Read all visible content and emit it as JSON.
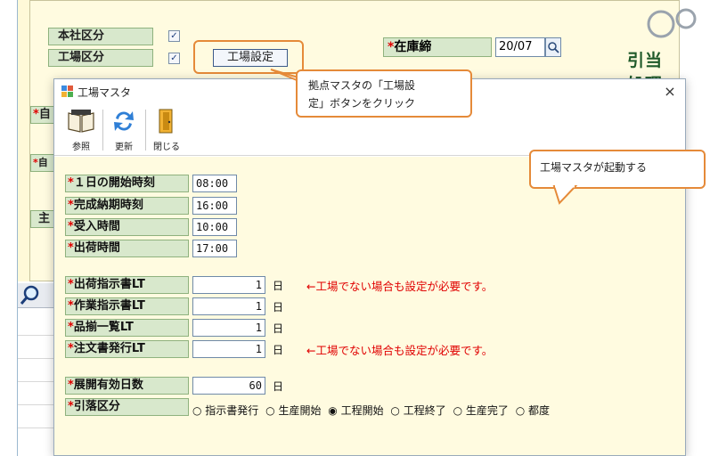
{
  "background": {
    "head_office_label": "本社区分",
    "factory_label": "工場区分",
    "factory_setting_button": "工場設定",
    "stock_cutoff_label": "在庫締",
    "stock_cutoff_required": "*",
    "stock_cutoff_value": "20/07",
    "right_title": "引当処理",
    "left_partial_1": "自",
    "left_partial_2": "自",
    "left_partial_3": "主"
  },
  "dialog": {
    "title": "工場マスタ",
    "close_symbol": "×",
    "toolbar": [
      {
        "label": "参照",
        "icon": "book-icon"
      },
      {
        "label": "更新",
        "icon": "refresh-icon"
      },
      {
        "label": "閉じる",
        "icon": "door-exit-icon"
      }
    ],
    "fields": [
      {
        "required": "*",
        "label": "１日の開始時刻",
        "value": "08:00"
      },
      {
        "required": "*",
        "label": "完成納期時刻",
        "value": "16:00"
      },
      {
        "required": "*",
        "label": "受入時間",
        "value": "10:00"
      },
      {
        "required": "*",
        "label": "出荷時間",
        "value": "17:00"
      }
    ],
    "lt_fields": [
      {
        "required": "*",
        "label": "出荷指示書LT",
        "value": "1",
        "unit": "日",
        "note": "←工場でない場合も設定が必要です。"
      },
      {
        "required": "*",
        "label": "作業指示書LT",
        "value": "1",
        "unit": "日",
        "note": ""
      },
      {
        "required": "*",
        "label": "品揃一覧LT",
        "value": "1",
        "unit": "日",
        "note": ""
      },
      {
        "required": "*",
        "label": "注文書発行LT",
        "value": "1",
        "unit": "日",
        "note": "←工場でない場合も設定が必要です。"
      }
    ],
    "expand_days": {
      "required": "*",
      "label": "展開有効日数",
      "value": "60",
      "unit": "日"
    },
    "deduction": {
      "required": "*",
      "label": "引落区分",
      "options": [
        {
          "label": "指示書発行",
          "selected": false
        },
        {
          "label": "生産開始",
          "selected": false
        },
        {
          "label": "工程開始",
          "selected": true
        },
        {
          "label": "工程終了",
          "selected": false
        },
        {
          "label": "生産完了",
          "selected": false
        },
        {
          "label": "都度",
          "selected": false
        }
      ]
    }
  },
  "callouts": {
    "click_button": "拠点マスタの「工場設定」ボタンをクリック",
    "click_button_line1": "拠点マスタの「工場設",
    "click_button_line2": "定」ボタンをクリック",
    "launch": "工場マスタが起動する"
  },
  "colors": {
    "form_background": "#fffbe0",
    "label_green": "#d8e8cc",
    "required_red": "#e00000",
    "callout_orange": "#e58a39"
  }
}
